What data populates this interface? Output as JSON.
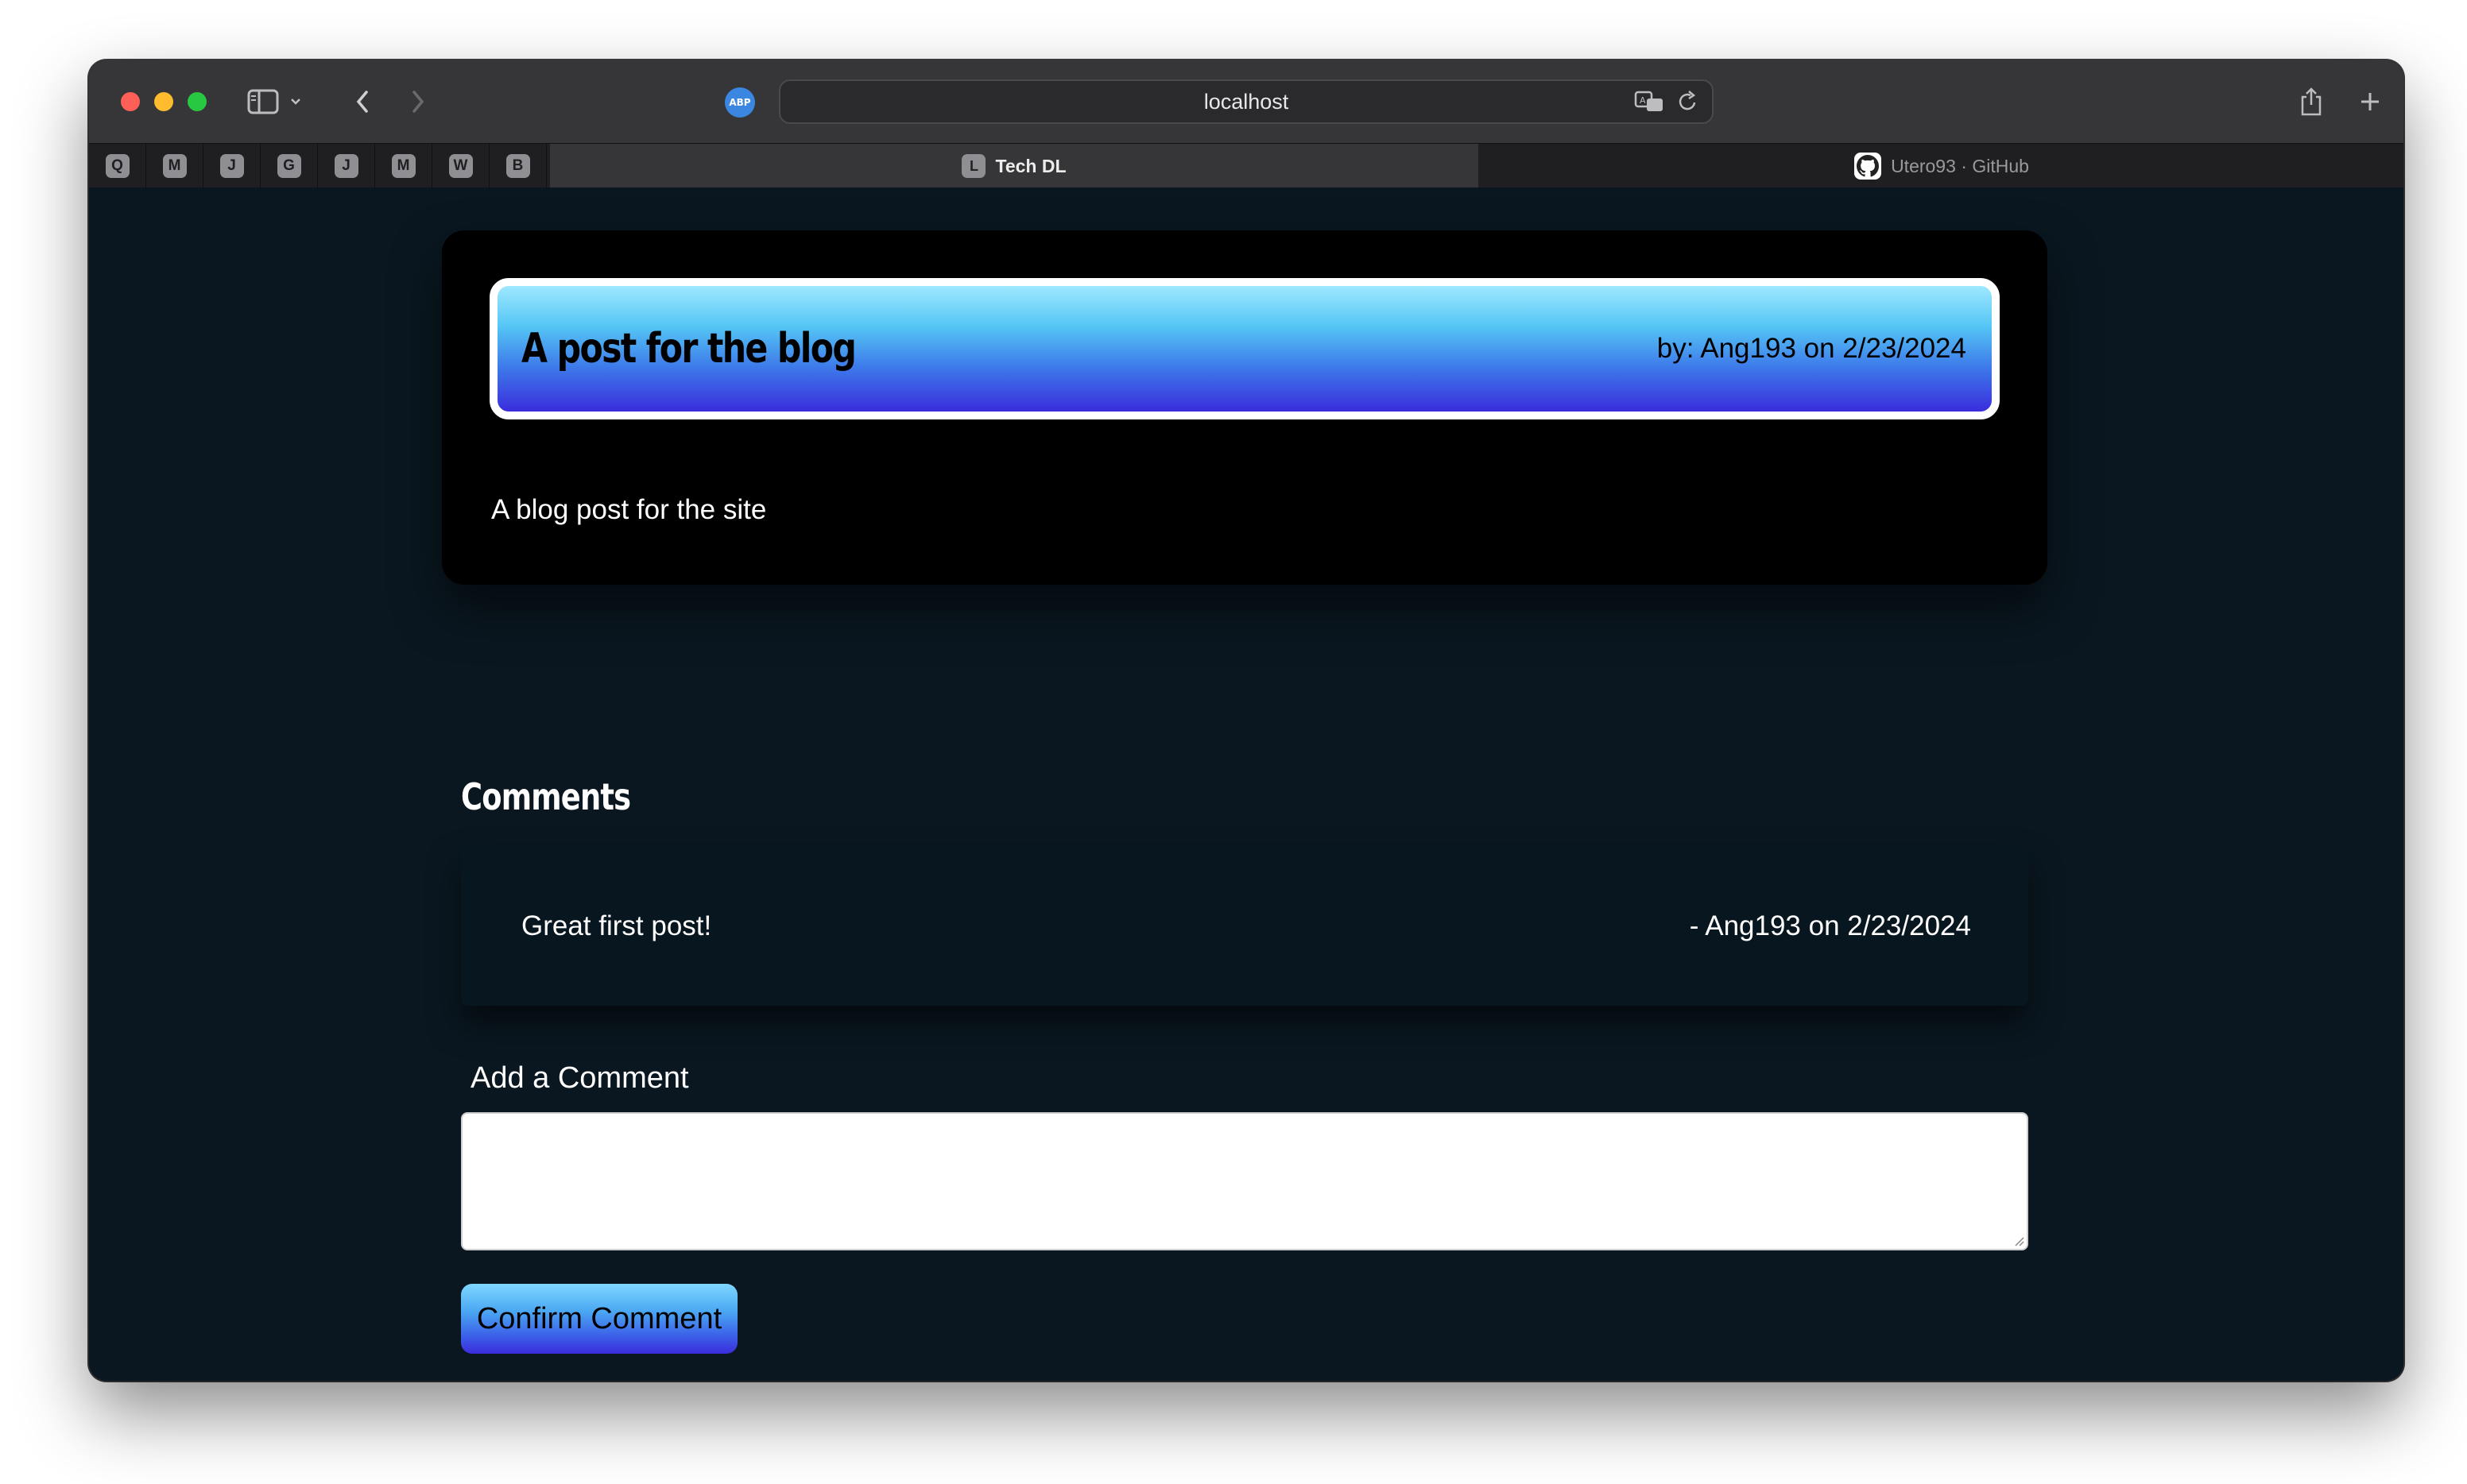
{
  "browser": {
    "url": "localhost",
    "abp_label": "ABP",
    "pinned_tabs": [
      "Q",
      "M",
      "J",
      "G",
      "J",
      "M",
      "W",
      "B"
    ],
    "tabs": [
      {
        "label": "Tech DL",
        "favicon": "L",
        "active": true
      },
      {
        "label": "Utero93 · GitHub",
        "favicon": "github-icon",
        "active": false
      }
    ]
  },
  "post": {
    "title": "A post for the blog",
    "meta": "by: Ang193 on 2/23/2024",
    "body": "A blog post for the site"
  },
  "comments": {
    "heading": "Comments",
    "items": [
      {
        "text": "Great first post!",
        "meta": "- Ang193 on 2/23/2024"
      }
    ]
  },
  "add_comment": {
    "label": "Add a Comment",
    "value": "",
    "button_label": "Confirm Comment"
  },
  "colors": {
    "page_background": "#0a1720",
    "card_background": "#000000",
    "header_gradient_top": "#9fe8ff",
    "header_gradient_bottom": "#3a2ddc"
  }
}
